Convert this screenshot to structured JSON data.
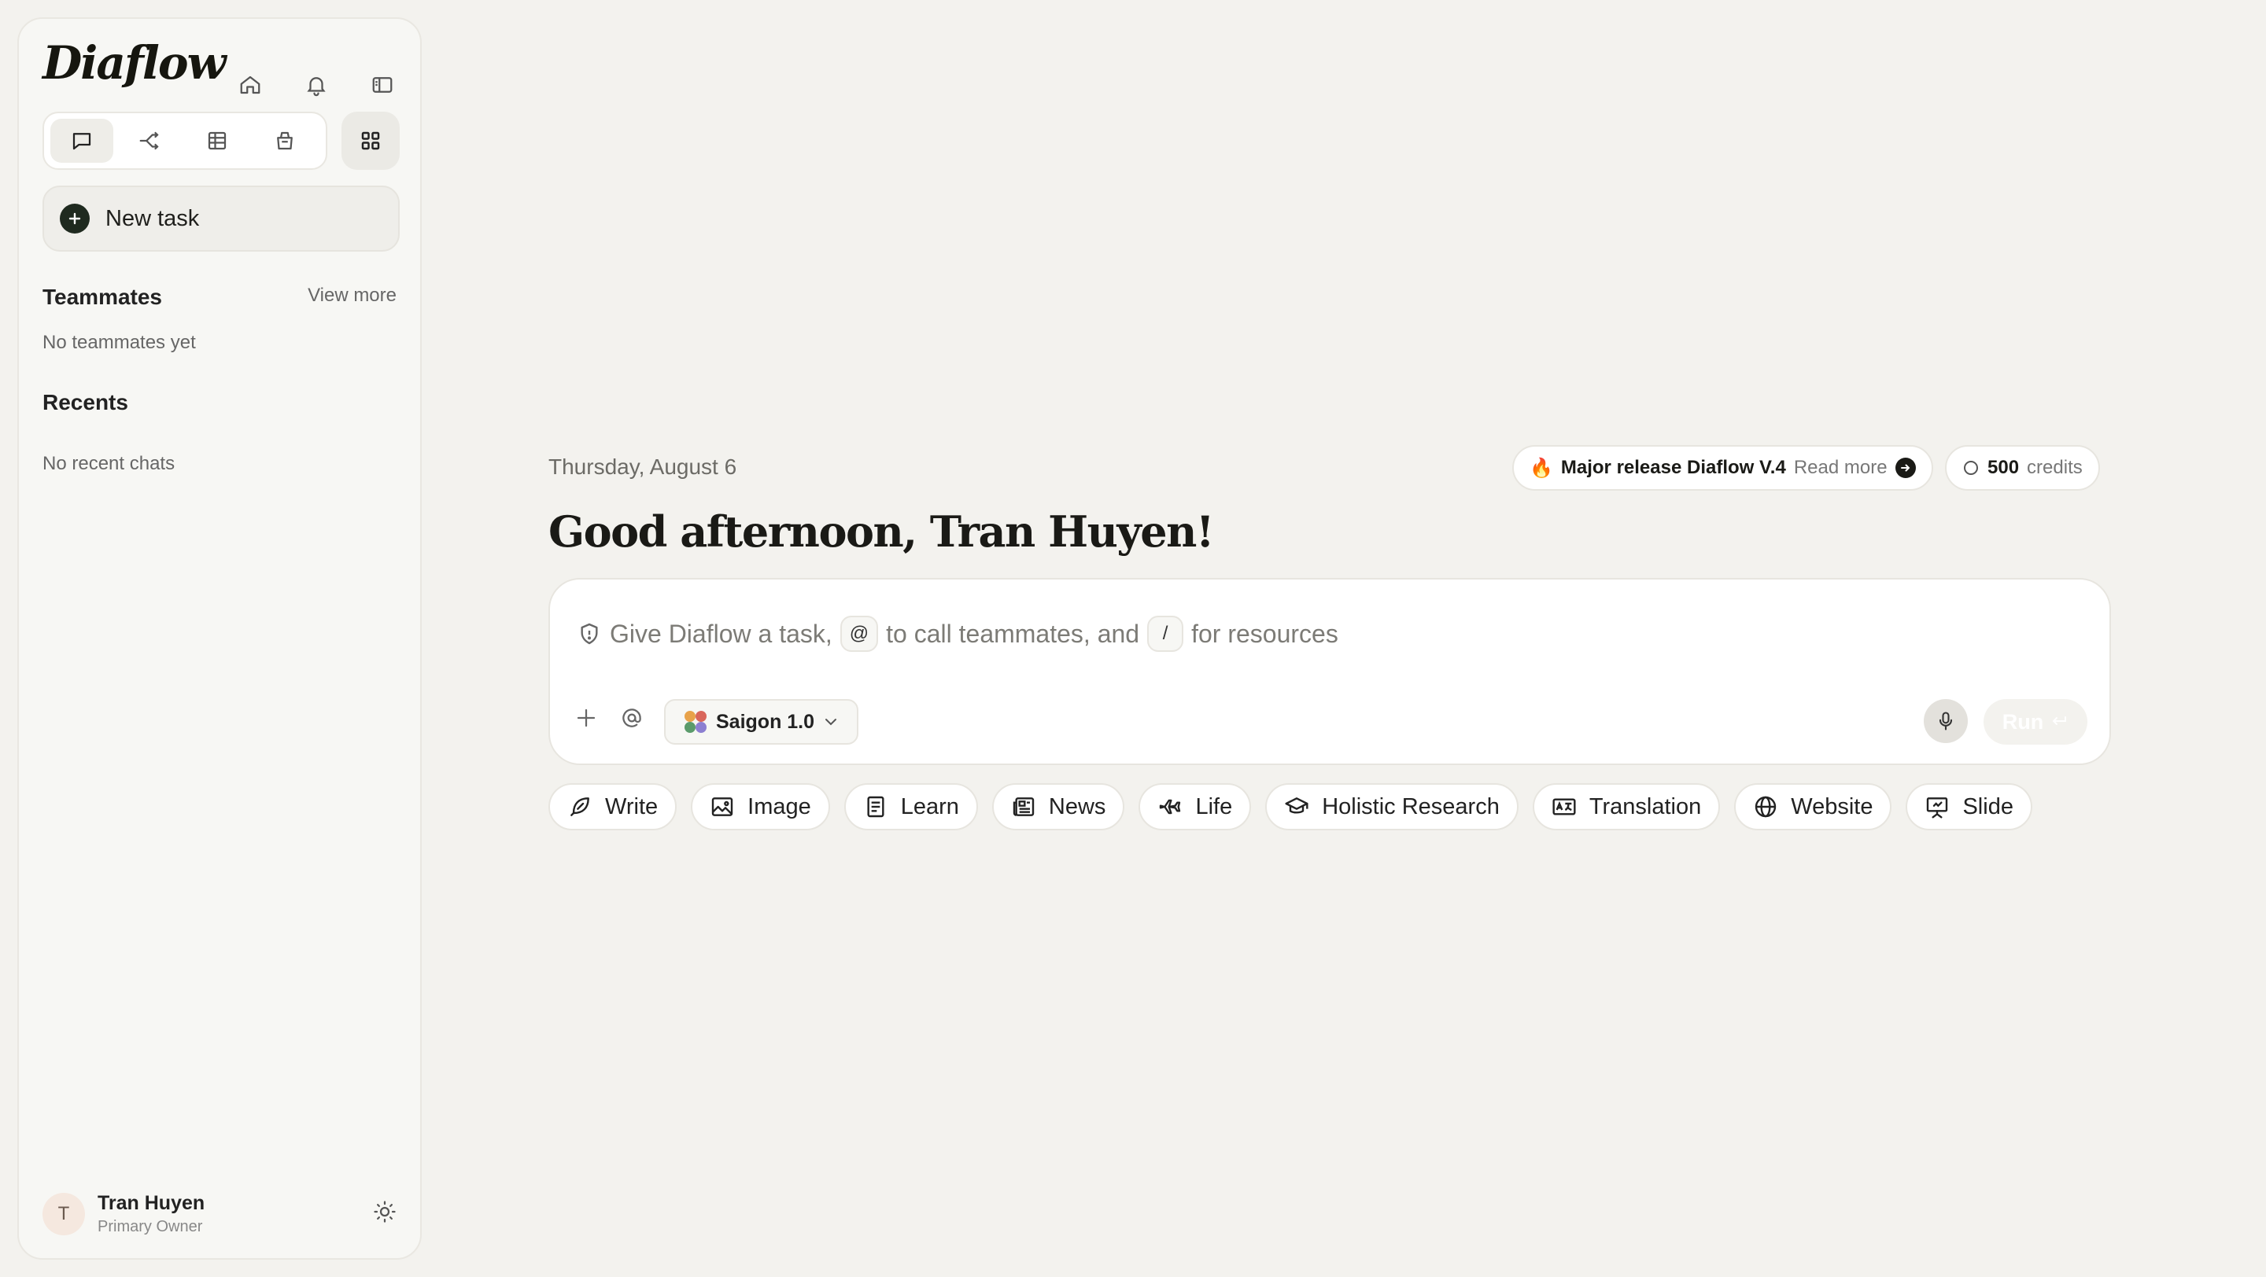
{
  "app": {
    "logo": "Diaflow"
  },
  "sidebar": {
    "new_task_label": "New task",
    "teammates_title": "Teammates",
    "view_more": "View more",
    "no_teammates": "No teammates yet",
    "recents_title": "Recents",
    "no_recents": "No recent chats",
    "user": {
      "initial": "T",
      "name": "Tran Huyen",
      "role": "Primary Owner"
    }
  },
  "main": {
    "date": "Thursday, August 6",
    "greeting": "Good afternoon, Tran Huyen!",
    "release": {
      "emoji": "🔥",
      "title": "Major release Diaflow V.4",
      "link": "Read more"
    },
    "credits": {
      "amount": "500",
      "label": "credits"
    },
    "prompt": {
      "part1": "Give Diaflow a task,",
      "key_at": "@",
      "part2": "to call teammates, and",
      "key_slash": "/",
      "part3": "for resources"
    },
    "model": "Saigon 1.0",
    "run_label": "Run",
    "chips": [
      "Write",
      "Image",
      "Learn",
      "News",
      "Life",
      "Holistic Research",
      "Translation",
      "Website",
      "Slide"
    ]
  }
}
